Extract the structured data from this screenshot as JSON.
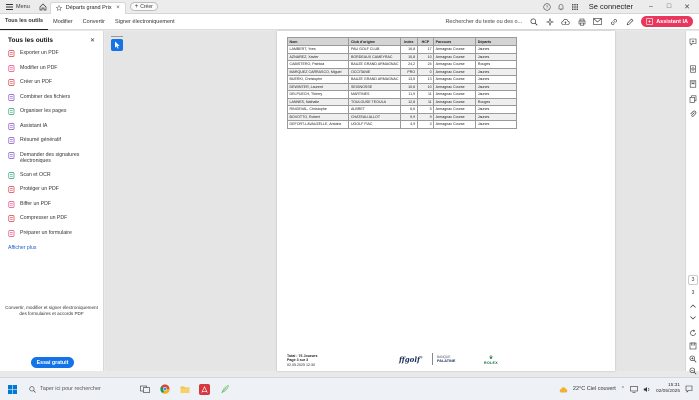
{
  "titlebar": {
    "menu_label": "Menu",
    "doc_tab_label": "Départs grand Prix d...",
    "create_label": "Créer",
    "signin_label": "Se connecter"
  },
  "toolbar": {
    "tabs": [
      "Tous les outils",
      "Modifier",
      "Convertir",
      "Signer électroniquement"
    ],
    "search_text": "Rechercher du texte ou des o...",
    "ai_label": "Assistant IA"
  },
  "left_panel": {
    "title": "Tous les outils",
    "items": [
      {
        "label": "Exporter un PDF",
        "icon": "export-pdf-icon",
        "color": "#d7373f"
      },
      {
        "label": "Modifier un PDF",
        "icon": "edit-pdf-icon",
        "color": "#e0457b"
      },
      {
        "label": "Créer un PDF",
        "icon": "create-pdf-icon",
        "color": "#d7373f"
      },
      {
        "label": "Combiner des fichiers",
        "icon": "combine-files-icon",
        "color": "#7c4dbd"
      },
      {
        "label": "Organiser les pages",
        "icon": "organize-pages-icon",
        "color": "#2d9d78"
      },
      {
        "label": "Assistant IA",
        "icon": "ai-assistant-icon",
        "color": "#7c4dbd"
      },
      {
        "label": "Résumé génératif",
        "icon": "generative-summary-icon",
        "color": "#7c4dbd"
      },
      {
        "label": "Demander des signatures électroniques",
        "icon": "request-signature-icon",
        "color": "#7c4dbd"
      },
      {
        "label": "Scan et OCR",
        "icon": "scan-ocr-icon",
        "color": "#2d9d78"
      },
      {
        "label": "Protéger un PDF",
        "icon": "protect-pdf-icon",
        "color": "#d7373f"
      },
      {
        "label": "Biffer un PDF",
        "icon": "redact-pdf-icon",
        "color": "#e0457b"
      },
      {
        "label": "Compresser un PDF",
        "icon": "compress-pdf-icon",
        "color": "#d7373f"
      },
      {
        "label": "Préparer un formulaire",
        "icon": "prepare-form-icon",
        "color": "#e0457b"
      }
    ],
    "more_label": "Afficher plus",
    "promo_text": "Convertir, modifier et signer électroniquement des formulaires et accords PDF",
    "trial_label": "Essai gratuit"
  },
  "document": {
    "columns": [
      "Nom",
      "Club d'origine",
      "Index",
      "HCP",
      "Parcours",
      "Départs"
    ],
    "rows": [
      [
        "LAMBERT, Yves",
        "PAU GOLF CLUB",
        "16,8",
        "17",
        "Armagnac Course",
        "Jaunes"
      ],
      [
        "AZNAREZ, Xavier",
        "BORDEAUX CAMEYRAC",
        "10,8",
        "10",
        "Armagnac Course",
        "Jaunes"
      ],
      [
        "CABISTERO, Patricia",
        "BAUZE GRAND ARMAGNAC",
        "24,2",
        "24",
        "Armagnac Course",
        "Rouges"
      ],
      [
        "MARQUEZ CARRASCO, Miguel",
        "OCCITANIE",
        "PRO",
        "0",
        "Armagnac Course",
        "Jaunes"
      ],
      [
        "BUERKI, Christophe",
        "BAUZE GRAND ARMAGNAC",
        "13,5",
        "13",
        "Armagnac Course",
        "Jaunes"
      ],
      [
        "DEWINTER, Laurent",
        "SEIGNOSSE",
        "10,6",
        "10",
        "Armagnac Course",
        "Jaunes"
      ],
      [
        "DELPUECH, Thierry",
        "MARTINES",
        "11,9",
        "11",
        "Armagnac Course",
        "Jaunes"
      ],
      [
        "LANNES, Nathalie",
        "TOULOUSE TEOULA",
        "12,8",
        "11",
        "Armagnac Course",
        "Rouges"
      ],
      [
        "RINGEVAL, Christophe",
        "ALBRET",
        "6,6",
        "5",
        "Armagnac Course",
        "Jaunes"
      ],
      [
        "BOVOTTO, Robert",
        "CHATEAU ALLOT",
        "9,9",
        "9",
        "Armagnac Course",
        "Jaunes"
      ],
      [
        "DEFORT-LAVAUZELLE, Antoine",
        "UGOLF FIAC",
        "4,9",
        "3",
        "Armagnac Course",
        "Jaunes"
      ]
    ],
    "footer": {
      "total": "Total : 76 Joueurs",
      "page": "Page 3 sur 3",
      "date": "02.05.2025 12:30"
    },
    "logos": {
      "ffgolf": "ffgolf",
      "sponsor_line1": "BANQUE",
      "sponsor_line2": "PALATINE",
      "rolex": "ROLEX"
    }
  },
  "right_rail": {
    "page_current": "3",
    "page_total": "3"
  },
  "taskbar": {
    "search_placeholder": "Taper ici pour rechercher",
    "weather": "22°C Ciel couvert",
    "time": "15:31",
    "date": "02/05/2025"
  },
  "colors": {
    "accent": "#1473e6",
    "ai_button": "#e8365d",
    "acrobat_red": "#d7373f"
  }
}
